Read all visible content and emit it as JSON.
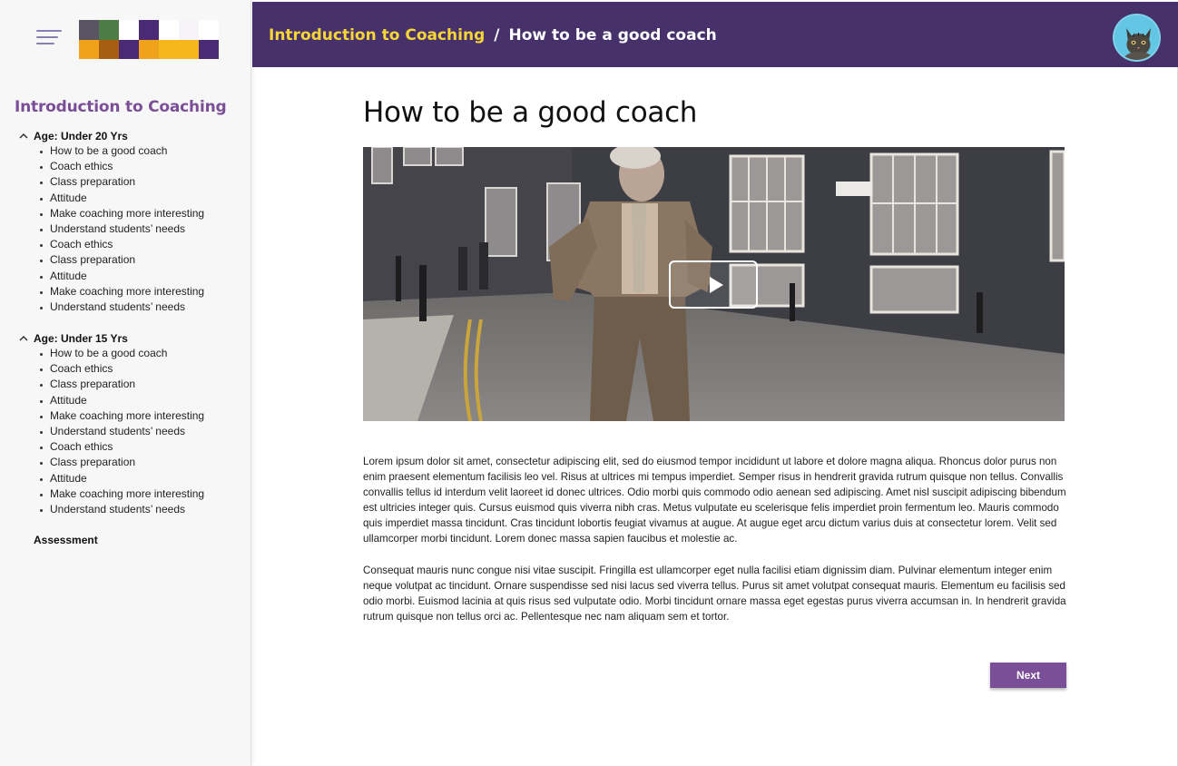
{
  "header": {
    "breadcrumb_course": "Introduction to Coaching",
    "breadcrumb_separator": "/",
    "breadcrumb_lesson": "How to be a good coach"
  },
  "sidebar": {
    "course_title": "Introduction to Coaching",
    "sections": [
      {
        "title": "Age: Under 20 Yrs",
        "items": [
          "How to be a good coach",
          "Coach ethics",
          "Class preparation",
          "Attitude",
          "Make coaching more interesting",
          "Understand students’ needs",
          "Coach ethics",
          "Class preparation",
          "Attitude",
          "Make coaching more interesting",
          "Understand students’ needs"
        ]
      },
      {
        "title": "Age: Under 15 Yrs",
        "items": [
          "How to be a good coach",
          "Coach ethics",
          "Class preparation",
          "Attitude",
          "Make coaching more interesting",
          "Understand students’ needs",
          "Coach ethics",
          "Class preparation",
          "Attitude",
          "Make coaching more interesting",
          "Understand students’ needs"
        ]
      }
    ],
    "assessment_label": "Assessment"
  },
  "main": {
    "title": "How to be a good coach",
    "paragraphs": [
      "Lorem ipsum dolor sit amet, consectetur adipiscing elit, sed do eiusmod tempor incididunt ut labore et dolore magna aliqua. Rhoncus dolor purus non enim praesent elementum facilisis leo vel. Risus at ultrices mi tempus imperdiet. Semper risus in hendrerit gravida rutrum quisque non tellus. Convallis convallis tellus id interdum velit laoreet id donec ultrices. Odio morbi quis commodo odio aenean sed adipiscing. Amet nisl suscipit adipiscing bibendum est ultricies integer quis. Cursus euismod quis viverra nibh cras. Metus vulputate eu scelerisque felis imperdiet proin fermentum leo. Mauris commodo quis imperdiet massa tincidunt. Cras tincidunt lobortis feugiat vivamus at augue. At augue eget arcu dictum varius duis at consectetur lorem. Velit sed ullamcorper morbi tincidunt. Lorem donec massa sapien faucibus et molestie ac.",
      "Consequat mauris nunc congue nisi vitae suscipit. Fringilla est ullamcorper eget nulla facilisi etiam dignissim diam. Pulvinar elementum integer enim neque volutpat ac tincidunt. Ornare suspendisse sed nisi lacus sed viverra tellus. Purus sit amet volutpat consequat mauris. Elementum eu facilisis sed odio morbi. Euismod lacinia at quis risus sed vulputate odio. Morbi tincidunt ornare massa eget egestas purus viverra accumsan in. In hendrerit gravida rutrum quisque non tellus orci ac. Pellentesque nec nam aliquam sem et tortor."
    ],
    "next_label": "Next"
  },
  "colors": {
    "header_bg": "#47316b",
    "breadcrumb_accent": "#f5d635",
    "brand_purple": "#7b4e98",
    "sidebar_bg": "#f7f7f7"
  },
  "icons": {
    "menu": "hamburger-icon",
    "expand": "chevron-up-icon",
    "play": "play-icon",
    "avatar": "cat-avatar"
  }
}
